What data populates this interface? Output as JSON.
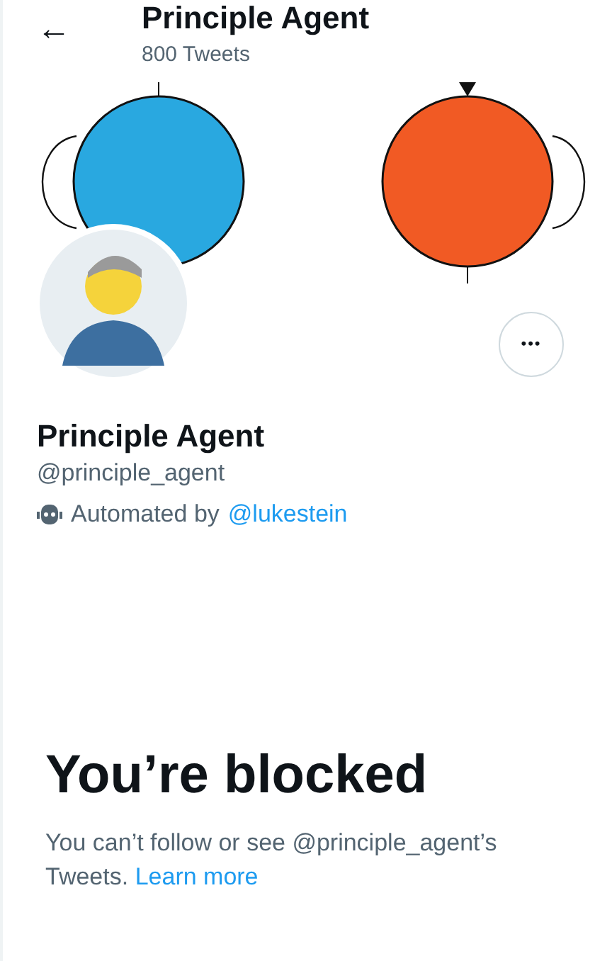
{
  "header": {
    "back": "←",
    "title": "Principle Agent",
    "subtitle": "800 Tweets"
  },
  "more_button": "•••",
  "profile": {
    "name": "Principle Agent",
    "handle": "@principle_agent",
    "automated_label": "Automated by",
    "automated_link": "@lukestein"
  },
  "blocked": {
    "title": "You’re blocked",
    "message": "You can’t follow or see @principle_agent’s Tweets.",
    "link": "Learn more"
  }
}
